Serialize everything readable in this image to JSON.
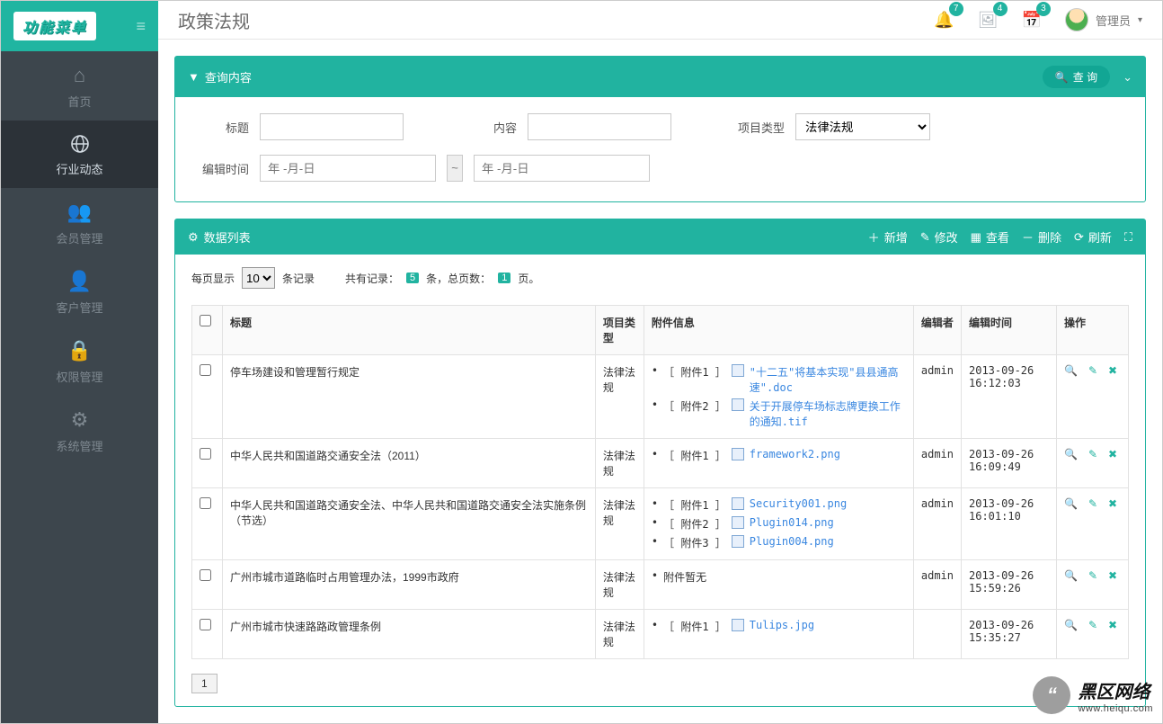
{
  "brand": "功能菜单",
  "page_title": "政策法规",
  "top_badges": {
    "bell": "7",
    "image": "4",
    "calendar": "3"
  },
  "user_label": "管理员",
  "sidebar": {
    "items": [
      {
        "label": "首页"
      },
      {
        "label": "行业动态"
      },
      {
        "label": "会员管理"
      },
      {
        "label": "客户管理"
      },
      {
        "label": "权限管理"
      },
      {
        "label": "系统管理"
      }
    ]
  },
  "query_panel": {
    "title": "查询内容",
    "search_btn": "查 询",
    "labels": {
      "title": "标题",
      "content": "内容",
      "project_type": "项目类型",
      "edit_time": "编辑时间"
    },
    "project_type_value": "法律法规",
    "date_placeholder": "年 -月-日",
    "date_sep": "~"
  },
  "list_panel": {
    "title": "数据列表",
    "toolbar": {
      "add": "新增",
      "edit": "修改",
      "view": "查看",
      "delete": "删除",
      "refresh": "刷新"
    },
    "meta": {
      "per_page_prefix": "每页显示",
      "per_page_value": "10",
      "per_page_suffix": "条记录",
      "total_prefix": "共有记录：",
      "total_count": "5",
      "total_mid": "条，总页数：",
      "total_pages": "1",
      "total_suffix": "页。"
    },
    "columns": {
      "title": "标题",
      "type": "项目类型",
      "attach": "附件信息",
      "editor": "编辑者",
      "time": "编辑时间",
      "actions": "操作"
    },
    "rows": [
      {
        "title": "停车场建设和管理暂行规定",
        "type": "法律法规",
        "attachments": [
          {
            "label": "［ 附件1 ］",
            "file": "\"十二五\"将基本实现\"县县通高速\".doc"
          },
          {
            "label": "［ 附件2 ］",
            "file": "关于开展停车场标志牌更换工作的通知.tif"
          }
        ],
        "editor": "admin",
        "time": "2013-09-26 16:12:03"
      },
      {
        "title": "中华人民共和国道路交通安全法（2011）",
        "type": "法律法规",
        "attachments": [
          {
            "label": "［ 附件1 ］",
            "file": "framework2.png"
          }
        ],
        "editor": "admin",
        "time": "2013-09-26 16:09:49"
      },
      {
        "title": "中华人民共和国道路交通安全法、中华人民共和国道路交通安全法实施条例（节选）",
        "type": "法律法规",
        "attachments": [
          {
            "label": "［ 附件1 ］",
            "file": "Security001.png"
          },
          {
            "label": "［ 附件2 ］",
            "file": "Plugin014.png"
          },
          {
            "label": "［ 附件3 ］",
            "file": "Plugin004.png"
          }
        ],
        "editor": "admin",
        "time": "2013-09-26 16:01:10"
      },
      {
        "title": "广州市城市道路临时占用管理办法，1999市政府",
        "type": "法律法规",
        "attachments_empty": "附件暂无",
        "editor": "admin",
        "time": "2013-09-26 15:59:26"
      },
      {
        "title": "广州市城市快速路路政管理条例",
        "type": "法律法规",
        "attachments": [
          {
            "label": "［ 附件1 ］",
            "file": "Tulips.jpg"
          }
        ],
        "editor": "",
        "time": "2013-09-26 15:35:27"
      }
    ],
    "pager": {
      "current": "1"
    }
  },
  "watermark": {
    "brand": "黑区网络",
    "url": "www.heiqu.com"
  }
}
